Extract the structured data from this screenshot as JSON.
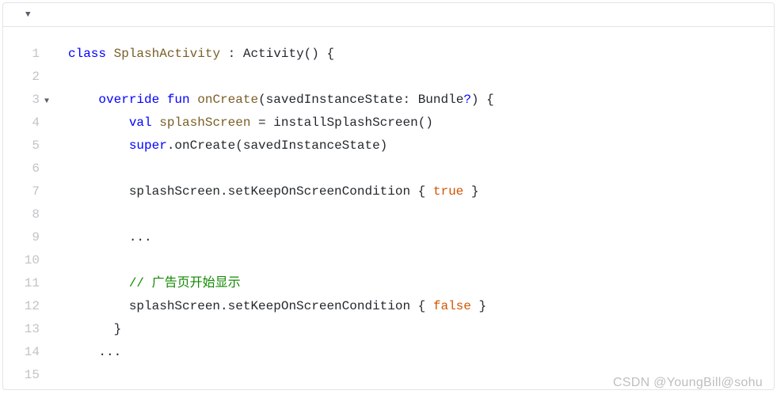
{
  "toolbar": {
    "caret": "▼"
  },
  "gutter": {
    "lines": [
      "1",
      "2",
      "3",
      "4",
      "5",
      "6",
      "7",
      "8",
      "9",
      "10",
      "11",
      "12",
      "13",
      "14",
      "15"
    ],
    "fold_line": 3,
    "fold_marker": "▼"
  },
  "code": {
    "line1": {
      "kw_class": "class",
      "type": "SplashActivity",
      "rest": " : Activity() {"
    },
    "line3": {
      "indent": "    ",
      "kw_override": "override",
      "kw_fun": "fun",
      "fn": "onCreate",
      "params_open": "(savedInstanceState: ",
      "type_bundle": "Bundle",
      "qmark": "?",
      "params_close": ") {"
    },
    "line4": {
      "indent": "        ",
      "kw_val": "val",
      "var": "splashScreen",
      "rest": " = installSplashScreen()"
    },
    "line5": {
      "indent": "        ",
      "kw_super": "super",
      "rest": ".onCreate(savedInstanceState)"
    },
    "line7": {
      "indent": "        ",
      "call": "splashScreen.setKeepOnScreenCondition { ",
      "lit": "true",
      "close": " }"
    },
    "line9": {
      "indent": "        ",
      "dots": "..."
    },
    "line11": {
      "indent": "        ",
      "comment": "// 广告页开始显示"
    },
    "line12": {
      "indent": "        ",
      "call": "splashScreen.setKeepOnScreenCondition { ",
      "lit": "false",
      "close": " }"
    },
    "line13": {
      "indent": "      ",
      "brace": "}"
    },
    "line14": {
      "indent": "    ",
      "dots": "..."
    }
  },
  "watermark": "CSDN @YoungBill@sohu"
}
